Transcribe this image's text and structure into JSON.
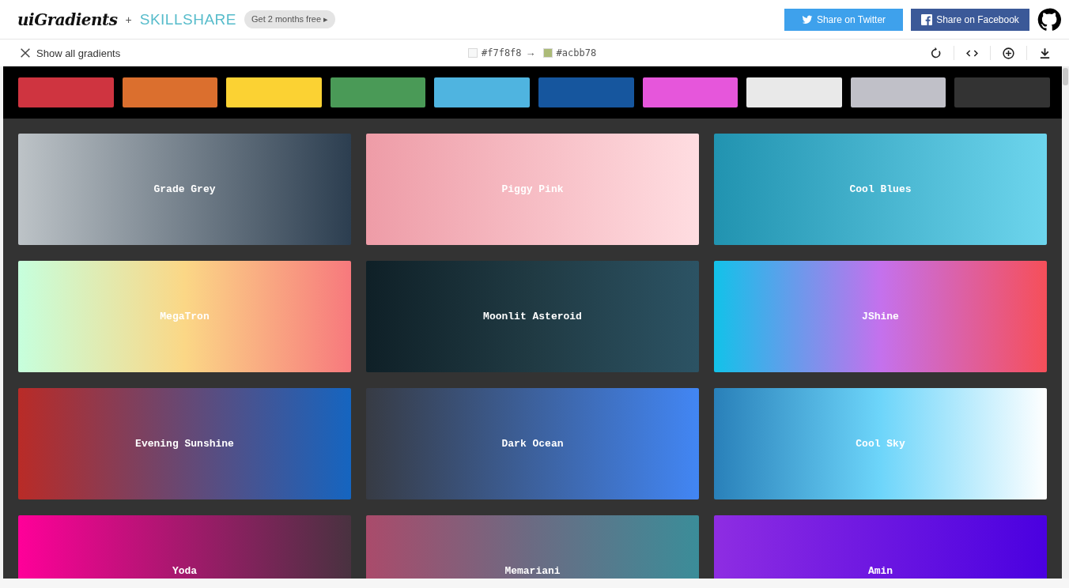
{
  "header": {
    "logo": "uiGradients",
    "plus": "+",
    "partner": "SKILLSHARE",
    "promo": "Get 2 months free ▸",
    "share_buttons": [
      {
        "kind": "twitter",
        "label": "Share on Twitter"
      },
      {
        "kind": "facebook",
        "label": "Share on Facebook"
      }
    ]
  },
  "toolbar": {
    "show_all": "Show all gradients",
    "from": {
      "color": "#f7f8f8",
      "label": "#f7f8f8"
    },
    "arrow": "→",
    "to": {
      "color": "#acbb78",
      "label": "#acbb78"
    },
    "actions": [
      {
        "kind": "rotate"
      },
      {
        "kind": "code"
      },
      {
        "kind": "add"
      },
      {
        "kind": "download"
      }
    ]
  },
  "color_filters": [
    {
      "color": "#cf3440"
    },
    {
      "color": "#db6f2e"
    },
    {
      "color": "#fbd233"
    },
    {
      "color": "#4a9a57"
    },
    {
      "color": "#4fb4e0"
    },
    {
      "color": "#16569e"
    },
    {
      "color": "#e656db"
    },
    {
      "color": "#e9e9e9"
    },
    {
      "color": "#c0c0c8"
    },
    {
      "color": "#333333"
    }
  ],
  "gradients": [
    {
      "name": "Grade Grey",
      "stops": [
        {
          "color": "#bdc3c7"
        },
        {
          "color": "#2c3e50"
        }
      ]
    },
    {
      "name": "Piggy Pink",
      "stops": [
        {
          "color": "#ee9ca7"
        },
        {
          "color": "#ffdde1"
        }
      ]
    },
    {
      "name": "Cool Blues",
      "stops": [
        {
          "color": "#2193b0"
        },
        {
          "color": "#6dd5ed"
        }
      ]
    },
    {
      "name": "MegaTron",
      "stops": [
        {
          "color": "#c6ffdd"
        },
        {
          "color": "#fbd786"
        },
        {
          "color": "#f7797d"
        }
      ]
    },
    {
      "name": "Moonlit Asteroid",
      "stops": [
        {
          "color": "#0f2027"
        },
        {
          "color": "#203a43"
        },
        {
          "color": "#2c5364"
        }
      ]
    },
    {
      "name": "JShine",
      "stops": [
        {
          "color": "#12c2e9"
        },
        {
          "color": "#c471ed"
        },
        {
          "color": "#f64f59"
        }
      ]
    },
    {
      "name": "Evening Sunshine",
      "stops": [
        {
          "color": "#b92b27"
        },
        {
          "color": "#1565c0"
        }
      ]
    },
    {
      "name": "Dark Ocean",
      "stops": [
        {
          "color": "#373b44"
        },
        {
          "color": "#4286f4"
        }
      ]
    },
    {
      "name": "Cool Sky",
      "stops": [
        {
          "color": "#2980b9"
        },
        {
          "color": "#6dd5fa"
        },
        {
          "color": "#ffffff"
        }
      ]
    },
    {
      "name": "Yoda",
      "stops": [
        {
          "color": "#ff0099"
        },
        {
          "color": "#493240"
        }
      ]
    },
    {
      "name": "Memariani",
      "stops": [
        {
          "color": "#aa4b6b"
        },
        {
          "color": "#6b6b83"
        },
        {
          "color": "#3b8d99"
        }
      ]
    },
    {
      "name": "Amin",
      "stops": [
        {
          "color": "#8e2de2"
        },
        {
          "color": "#4a00e0"
        }
      ]
    }
  ]
}
